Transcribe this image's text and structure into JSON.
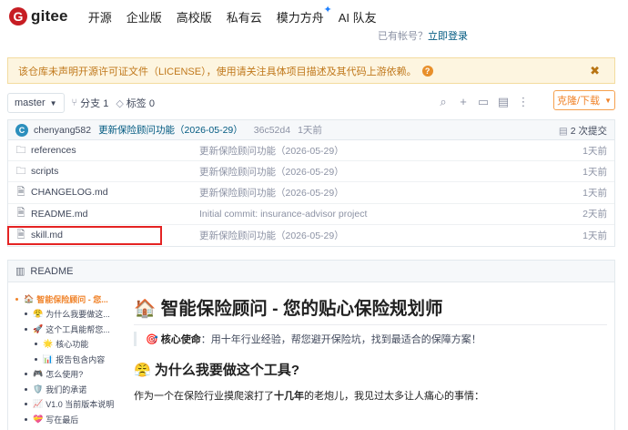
{
  "header": {
    "logo_glyph": "G",
    "logo_text": "gitee",
    "nav": [
      "开源",
      "企业版",
      "高校版",
      "私有云",
      "模力方舟",
      "AI 队友"
    ],
    "spark": "✦",
    "login_hint_prefix": "已有帐号？",
    "login_hint_link": "立即登录"
  },
  "alert": {
    "text": "该仓库未声明开源许可证文件（LICENSE），使用请关注具体项目描述及其代码上游依赖。",
    "help_glyph": "?",
    "close_glyph": "✖"
  },
  "toolbar": {
    "branch": "master",
    "branches_label": "分支 1",
    "tags_label": "标签 0",
    "clone_label": "克隆/下载"
  },
  "commit": {
    "avatar_letter": "C",
    "author": "chenyang582",
    "message": "更新保险顾问功能（2026-05-29）",
    "sha": "36c52d4",
    "time": "1天前",
    "count_label": "2 次提交"
  },
  "files": [
    {
      "type": "folder",
      "name": "references",
      "message": "更新保险顾问功能（2026-05-29）",
      "time": "1天前"
    },
    {
      "type": "folder",
      "name": "scripts",
      "message": "更新保险顾问功能（2026-05-29）",
      "time": "1天前"
    },
    {
      "type": "file",
      "name": "CHANGELOG.md",
      "message": "更新保险顾问功能（2026-05-29）",
      "time": "1天前"
    },
    {
      "type": "file",
      "name": "README.md",
      "message": "Initial commit: insurance-advisor project",
      "time": "2天前"
    },
    {
      "type": "file",
      "name": "skill.md",
      "message": "更新保险顾问功能（2026-05-29）",
      "time": "1天前"
    }
  ],
  "readme": {
    "tab_label": "README",
    "toc": [
      {
        "level": 1,
        "emoji": "🏠",
        "label": "智能保险顾问 - 您...",
        "active": true
      },
      {
        "level": 2,
        "emoji": "😤",
        "label": "为什么我要做这...",
        "active": false
      },
      {
        "level": 2,
        "emoji": "🚀",
        "label": "这个工具能帮您...",
        "active": false
      },
      {
        "level": 3,
        "emoji": "🌟",
        "label": "核心功能",
        "active": false
      },
      {
        "level": 3,
        "emoji": "📊",
        "label": "报告包含内容",
        "active": false
      },
      {
        "level": 2,
        "emoji": "🎮",
        "label": "怎么使用?",
        "active": false
      },
      {
        "level": 2,
        "emoji": "🛡️",
        "label": "我们的承诺",
        "active": false
      },
      {
        "level": 2,
        "emoji": "📈",
        "label": "V1.0 当前版本说明",
        "active": false
      },
      {
        "level": 2,
        "emoji": "💝",
        "label": "写在最后",
        "active": false
      }
    ],
    "title_emoji": "🏠",
    "title": "智能保险顾问 - 您的贴心保险规划师",
    "mission_emoji": "🎯",
    "mission_label": "核心使命",
    "mission_text": "：用十年行业经验，帮您避开保险坑，找到最适合的保障方案！",
    "section_emoji": "😤",
    "section_title": "为什么我要做这个工具?",
    "para_before": "作为一个在保险行业摸爬滚打了",
    "para_bold": "十几年",
    "para_after": "的老炮儿，我见过太多让人痛心的事情："
  }
}
